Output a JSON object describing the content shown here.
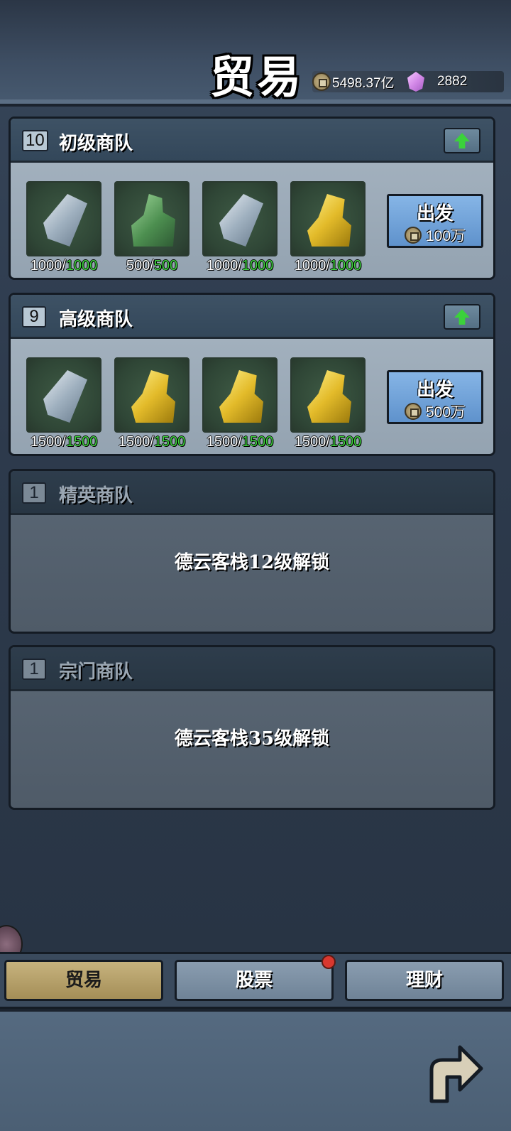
{
  "header": {
    "title": "贸易",
    "coins": "5498.37亿",
    "gems": "2882",
    "coin_icon": "coin-icon",
    "gem_icon": "gem-icon"
  },
  "caravans": [
    {
      "level": "10",
      "name": "初级商队",
      "items": [
        {
          "icon": "silver-ore-icon",
          "current": "1000",
          "max": "1000"
        },
        {
          "icon": "jade-ore-icon",
          "current": "500",
          "max": "500"
        },
        {
          "icon": "silver-ore-icon",
          "current": "1000",
          "max": "1000"
        },
        {
          "icon": "gold-ore-icon",
          "current": "1000",
          "max": "1000"
        }
      ],
      "depart_label": "出发",
      "cost": "100万"
    },
    {
      "level": "9",
      "name": "高级商队",
      "items": [
        {
          "icon": "silver-ore-icon",
          "current": "1500",
          "max": "1500"
        },
        {
          "icon": "gold-ore-icon",
          "current": "1500",
          "max": "1500"
        },
        {
          "icon": "gold-ore-icon",
          "current": "1500",
          "max": "1500"
        },
        {
          "icon": "gold-ore-icon",
          "current": "1500",
          "max": "1500"
        }
      ],
      "depart_label": "出发",
      "cost": "500万"
    },
    {
      "level": "1",
      "name": "精英商队",
      "lock_text": "德云客栈12级解锁"
    },
    {
      "level": "1",
      "name": "宗门商队",
      "lock_text": "德云客栈35级解锁"
    }
  ],
  "tabs": [
    {
      "label": "贸易",
      "active": true
    },
    {
      "label": "股票",
      "badge": true
    },
    {
      "label": "理财"
    }
  ],
  "colors": {
    "accent_green": "#3fd33f",
    "active_tab": "#c7b37e",
    "depart_button": "#6fa0d8",
    "badge": "#d9382f"
  }
}
